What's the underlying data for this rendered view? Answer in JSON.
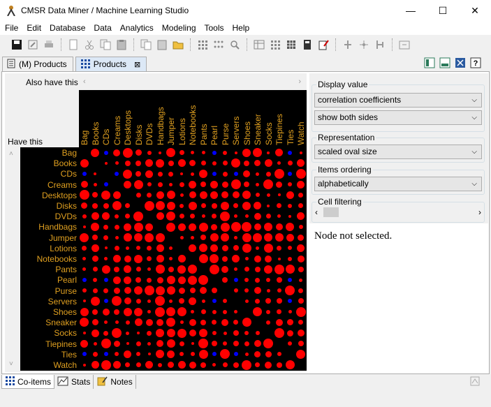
{
  "window": {
    "title": "CMSR Data Miner / Machine Learning Studio",
    "minimize": "—",
    "maximize": "☐",
    "close": "✕"
  },
  "menu": [
    "File",
    "Edit",
    "Database",
    "Data",
    "Analytics",
    "Modeling",
    "Tools",
    "Help"
  ],
  "tabs": [
    {
      "label": "(M) Products",
      "active": false
    },
    {
      "label": "Products",
      "active": true
    }
  ],
  "matrix": {
    "col_axis_label": "Also have this",
    "row_axis_label": "Have this",
    "items": [
      "Bag",
      "Books",
      "CDs",
      "Creams",
      "Desktops",
      "Disks",
      "DVDs",
      "Handbags",
      "Jumper",
      "Lotions",
      "Notebooks",
      "Pants",
      "Pearl",
      "Purse",
      "Servers",
      "Shoes",
      "Sneaker",
      "Socks",
      "Tiepines",
      "Ties",
      "Watch"
    ],
    "colors": {
      "positive": "#ff0000",
      "negative": "#0000ff",
      "background": "#000000",
      "label": "#e0a020"
    }
  },
  "settings": {
    "display_value_title": "Display value",
    "display_value": "correlation coefficients",
    "sides": "show both sides",
    "representation_title": "Representation",
    "representation": "scaled oval size",
    "ordering_title": "Items ordering",
    "ordering": "alphabetically",
    "filtering_title": "Cell filtering"
  },
  "notes_text": "Node not selected.",
  "bottom_tabs": [
    "Co-items",
    "Stats",
    "Notes"
  ]
}
